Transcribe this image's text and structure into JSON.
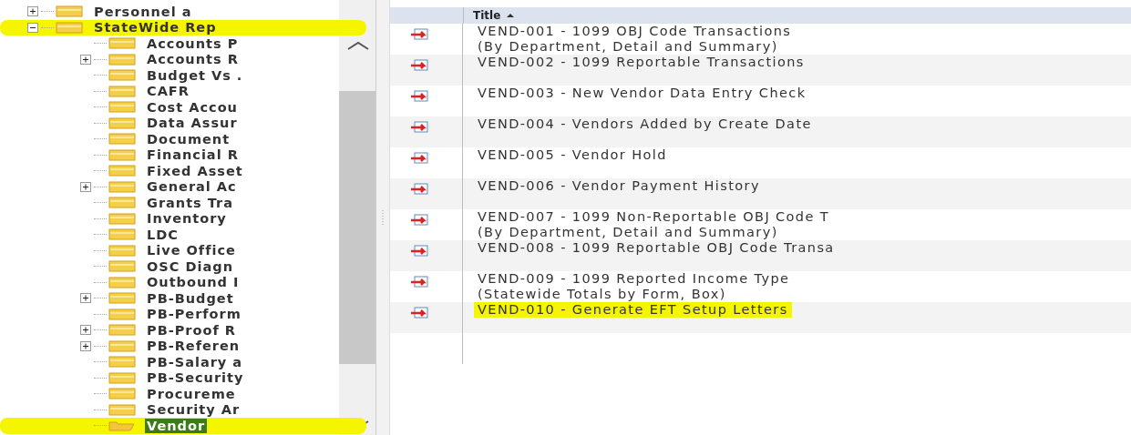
{
  "tree": [
    {
      "label": "Personnel a",
      "expanded": false,
      "selected": false,
      "highlighted": false
    },
    {
      "label": "StateWide Rep",
      "expanded": true,
      "selected": false,
      "highlighted": true,
      "children": [
        {
          "label": "Accounts P",
          "selected": false,
          "highlighted": false
        },
        {
          "label": "Accounts R",
          "expanded": false,
          "selected": false,
          "highlighted": false
        },
        {
          "label": "Budget Vs .",
          "selected": false,
          "highlighted": false
        },
        {
          "label": "CAFR",
          "selected": false,
          "highlighted": false
        },
        {
          "label": "Cost Accou",
          "selected": false,
          "highlighted": false
        },
        {
          "label": "Data Assur",
          "selected": false,
          "highlighted": false
        },
        {
          "label": "Document",
          "selected": false,
          "highlighted": false
        },
        {
          "label": "Financial R",
          "selected": false,
          "highlighted": false
        },
        {
          "label": "Fixed Asset",
          "selected": false,
          "highlighted": false
        },
        {
          "label": "General Ac",
          "expanded": false,
          "selected": false,
          "highlighted": false
        },
        {
          "label": "Grants Tra",
          "selected": false,
          "highlighted": false
        },
        {
          "label": "Inventory",
          "selected": false,
          "highlighted": false
        },
        {
          "label": "LDC",
          "selected": false,
          "highlighted": false
        },
        {
          "label": "Live Office",
          "selected": false,
          "highlighted": false
        },
        {
          "label": "OSC Diagn",
          "selected": false,
          "highlighted": false
        },
        {
          "label": "Outbound I",
          "selected": false,
          "highlighted": false
        },
        {
          "label": "PB-Budget",
          "expanded": false,
          "selected": false,
          "highlighted": false
        },
        {
          "label": "PB-Perform",
          "selected": false,
          "highlighted": false
        },
        {
          "label": "PB-Proof R",
          "expanded": false,
          "selected": false,
          "highlighted": false
        },
        {
          "label": "PB-Referen",
          "expanded": false,
          "selected": false,
          "highlighted": false
        },
        {
          "label": "PB-Salary a",
          "selected": false,
          "highlighted": false
        },
        {
          "label": "PB-Security",
          "selected": false,
          "highlighted": false
        },
        {
          "label": "Procureme",
          "selected": false,
          "highlighted": false
        },
        {
          "label": "Security Ar",
          "selected": false,
          "highlighted": false
        },
        {
          "label": "Vendor",
          "selected": true,
          "highlighted": true
        }
      ]
    }
  ],
  "table": {
    "columns": [
      {
        "label": "Title",
        "sort_ascending": true
      }
    ],
    "rows": [
      {
        "title": "VEND-001 - 1099 OBJ Code Transactions\n(By Department, Detail and Summary)",
        "highlighted": false
      },
      {
        "title": "VEND-002 - 1099 Reportable Transactions",
        "highlighted": false
      },
      {
        "title": "VEND-003 - New Vendor Data Entry Check",
        "highlighted": false
      },
      {
        "title": "VEND-004 - Vendors Added by Create Date",
        "highlighted": false
      },
      {
        "title": "VEND-005 - Vendor Hold",
        "highlighted": false
      },
      {
        "title": "VEND-006 - Vendor Payment History",
        "highlighted": false
      },
      {
        "title": "VEND-007 - 1099 Non-Reportable OBJ Code T\n(By Department, Detail and Summary)",
        "highlighted": false
      },
      {
        "title": "VEND-008 - 1099 Reportable OBJ Code Transa",
        "highlighted": false
      },
      {
        "title": "VEND-009 - 1099 Reported Income Type\n(Statewide Totals by Form, Box)",
        "highlighted": false
      },
      {
        "title": "VEND-010 - Generate EFT Setup Letters",
        "highlighted": true
      }
    ]
  }
}
